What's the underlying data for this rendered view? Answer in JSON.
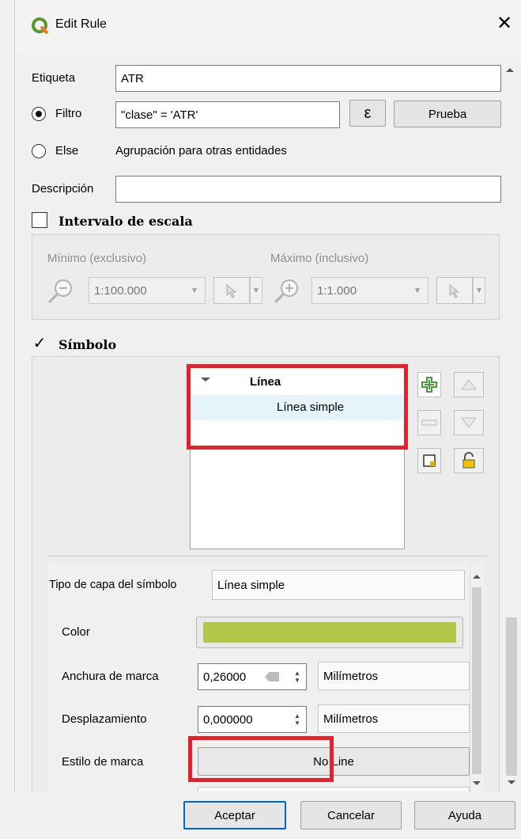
{
  "window": {
    "title": "Edit Rule",
    "close_glyph": "✕"
  },
  "form": {
    "etiqueta_label": "Etiqueta",
    "etiqueta_value": "ATR",
    "filtro_label": "Filtro",
    "filtro_value": "\"clase\" = 'ATR'",
    "expression_glyph": "ε",
    "prueba_label": "Prueba",
    "else_label": "Else",
    "else_desc": "Agrupación para otras entidades",
    "descripcion_label": "Descripción",
    "descripcion_value": ""
  },
  "scale": {
    "title": "Intervalo de escala",
    "checked": false,
    "min_label": "Mínimo (exclusivo)",
    "max_label": "Máximo (inclusivo)",
    "min_value": "1:100.000",
    "max_value": "1:1.000"
  },
  "symbol": {
    "title": "Símbolo",
    "check_glyph": "✓",
    "tree_root": "Línea",
    "tree_child": "Línea simple"
  },
  "layer_props": {
    "tipo_label": "Tipo de capa del símbolo",
    "tipo_value": "Línea simple",
    "color_label": "Color",
    "color_value": "#b5c74a",
    "anchura_label": "Anchura de marca",
    "anchura_value": "0,26000",
    "anchura_unit": "Milímetros",
    "desplaz_label": "Desplazamiento",
    "desplaz_value": "0,000000",
    "desplaz_unit": "Milímetros",
    "estilo_label": "Estilo de marca",
    "estilo_value": "No Line"
  },
  "buttons": {
    "accept": "Aceptar",
    "cancel": "Cancelar",
    "help": "Ayuda"
  },
  "colors": {
    "highlight_red": "#e0242b",
    "qgis_green": "#589632"
  }
}
